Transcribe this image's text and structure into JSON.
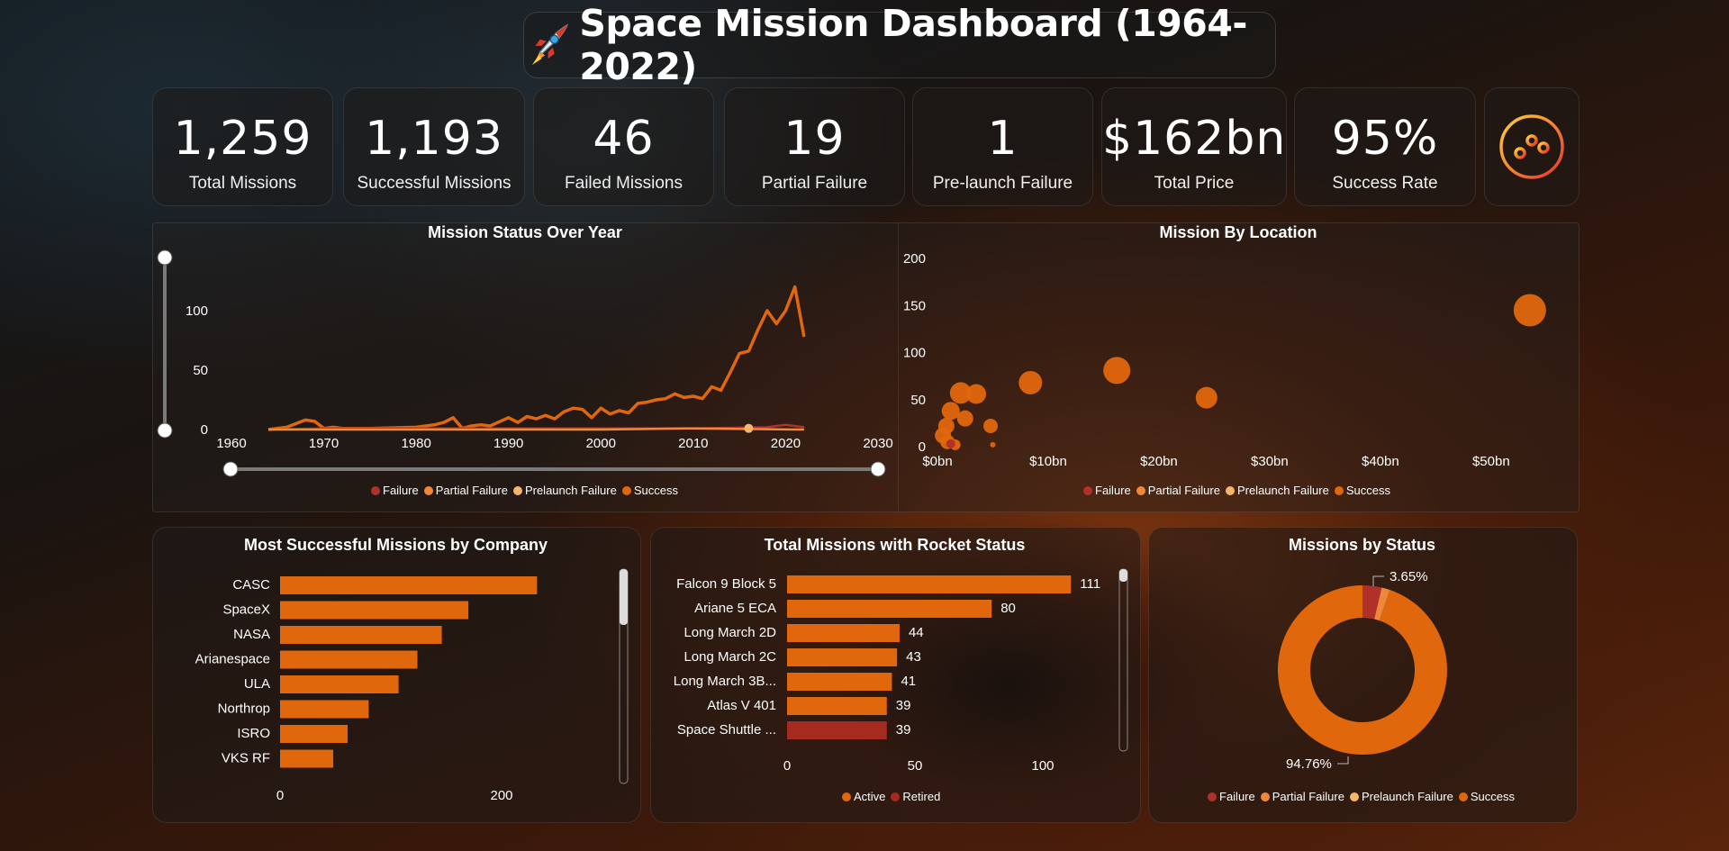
{
  "title": "Space Mission Dashboard (1964-2022)",
  "icons": {
    "title": "rocket-icon",
    "filter": "sliders-icon"
  },
  "kpis": [
    {
      "value": "1,259",
      "label": "Total Missions"
    },
    {
      "value": "1,193",
      "label": "Successful Missions"
    },
    {
      "value": "46",
      "label": "Failed Missions"
    },
    {
      "value": "19",
      "label": "Partial Failure"
    },
    {
      "value": "1",
      "label": "Pre-launch Failure"
    },
    {
      "value": "$162bn",
      "label": "Total Price"
    },
    {
      "value": "95%",
      "label": "Success Rate"
    }
  ],
  "colors": {
    "failure": "#b0302a",
    "partial": "#f0883a",
    "prelaunch": "#f5b56b",
    "success": "#e0670c",
    "retired": "#a52a20"
  },
  "legend_status": [
    "Failure",
    "Partial Failure",
    "Prelaunch Failure",
    "Success"
  ],
  "chart_data": [
    {
      "type": "line",
      "title": "Mission Status Over Year",
      "xlim": [
        1960,
        2030
      ],
      "xticks": [
        1960,
        1970,
        1980,
        1990,
        2000,
        2010,
        2020,
        2030
      ],
      "ylim": [
        0,
        125
      ],
      "yticks": [
        0,
        50,
        100
      ],
      "series": [
        {
          "name": "Success",
          "x": [
            1964,
            1966,
            1968,
            1969,
            1970,
            1971,
            1972,
            1975,
            1980,
            1982,
            1983,
            1984,
            1985,
            1986,
            1987,
            1988,
            1990,
            1991,
            1992,
            1993,
            1994,
            1995,
            1996,
            1997,
            1998,
            1999,
            2000,
            2001,
            2002,
            2003,
            2004,
            2005,
            2006,
            2007,
            2008,
            2009,
            2010,
            2011,
            2012,
            2013,
            2014,
            2015,
            2016,
            2017,
            2018,
            2019,
            2020,
            2021,
            2022
          ],
          "y": [
            0,
            2,
            8,
            7,
            1,
            2,
            1,
            1,
            2,
            4,
            6,
            10,
            1,
            3,
            4,
            3,
            10,
            6,
            11,
            9,
            12,
            9,
            15,
            18,
            17,
            10,
            18,
            13,
            16,
            14,
            22,
            23,
            25,
            26,
            30,
            27,
            28,
            26,
            36,
            33,
            48,
            64,
            66,
            84,
            100,
            89,
            100,
            120,
            78
          ]
        },
        {
          "name": "Failure",
          "x": [
            1964,
            1970,
            1980,
            1990,
            2000,
            2010,
            2018,
            2020,
            2022
          ],
          "y": [
            0,
            1,
            1,
            1,
            1,
            1,
            2,
            4,
            2
          ]
        },
        {
          "name": "Partial Failure",
          "x": [
            1964,
            1980,
            2000,
            2010,
            2022
          ],
          "y": [
            0,
            0,
            0,
            1,
            0
          ]
        },
        {
          "name": "Prelaunch Failure",
          "x": [
            2016
          ],
          "y": [
            1
          ]
        }
      ]
    },
    {
      "type": "scatter",
      "title": "Mission By Location",
      "x_unit": "bn",
      "xlim": [
        0,
        54
      ],
      "xticks": [
        "$0bn",
        "$10bn",
        "$20bn",
        "$30bn",
        "$40bn",
        "$50bn"
      ],
      "ylim": [
        0,
        200
      ],
      "yticks": [
        0,
        50,
        100,
        150,
        200
      ],
      "points": [
        {
          "x": 53.5,
          "y": 145,
          "r": 18
        },
        {
          "x": 16.2,
          "y": 81,
          "r": 15
        },
        {
          "x": 8.4,
          "y": 68,
          "r": 13
        },
        {
          "x": 24.3,
          "y": 52,
          "r": 12
        },
        {
          "x": 2.1,
          "y": 57,
          "r": 12
        },
        {
          "x": 3.5,
          "y": 56,
          "r": 11
        },
        {
          "x": 1.2,
          "y": 38,
          "r": 10
        },
        {
          "x": 2.5,
          "y": 30,
          "r": 9
        },
        {
          "x": 0.8,
          "y": 22,
          "r": 9
        },
        {
          "x": 0.5,
          "y": 12,
          "r": 9
        },
        {
          "x": 0.9,
          "y": 5,
          "r": 8
        },
        {
          "x": 4.8,
          "y": 22,
          "r": 8
        },
        {
          "x": 1.6,
          "y": 2,
          "r": 6
        },
        {
          "x": 5.0,
          "y": 2,
          "r": 3
        }
      ]
    },
    {
      "type": "bar",
      "title": "Most Successful Missions by Company",
      "categories": [
        "CASC",
        "SpaceX",
        "NASA",
        "Arianespace",
        "ULA",
        "Northrop",
        "ISRO",
        "VKS RF"
      ],
      "values": [
        232,
        170,
        146,
        124,
        107,
        80,
        61,
        48
      ],
      "xlim": [
        0,
        300
      ],
      "xticks": [
        0,
        200
      ]
    },
    {
      "type": "bar",
      "title": "Total Missions with Rocket Status",
      "categories": [
        "Falcon 9 Block 5",
        "Ariane 5 ECA",
        "Long March 2D",
        "Long March 2C",
        "Long March 3B...",
        "Atlas V 401",
        "Space Shuttle ..."
      ],
      "values": [
        111,
        80,
        44,
        43,
        41,
        39,
        39
      ],
      "status": [
        "Active",
        "Active",
        "Active",
        "Active",
        "Active",
        "Active",
        "Retired"
      ],
      "xlim": [
        0,
        130
      ],
      "xticks": [
        0,
        50,
        100
      ],
      "legend": [
        "Active",
        "Retired"
      ]
    },
    {
      "type": "pie",
      "title": "Missions by Status",
      "labels": [
        "Failure",
        "Partial Failure",
        "Prelaunch Failure",
        "Success"
      ],
      "values": [
        3.65,
        1.51,
        0.08,
        94.76
      ],
      "data_labels": [
        "3.65%",
        "94.76%"
      ]
    }
  ]
}
